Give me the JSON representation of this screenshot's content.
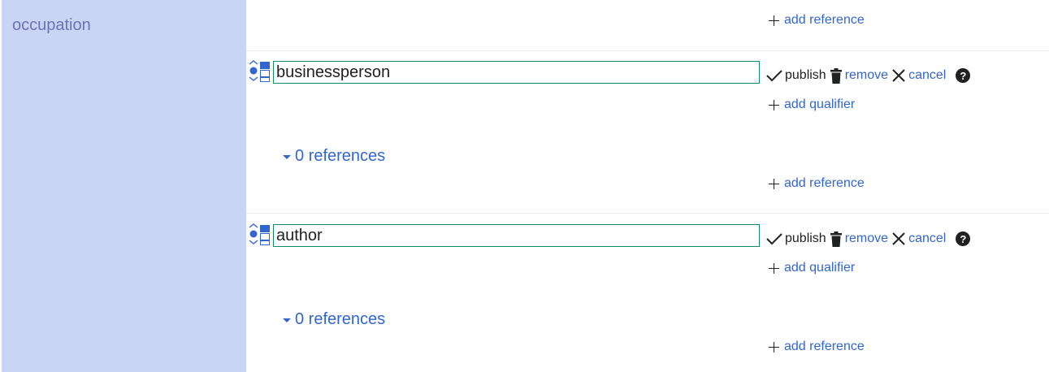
{
  "property": {
    "label": "occupation"
  },
  "actions": {
    "add_reference": "add reference",
    "add_qualifier": "add qualifier"
  },
  "toolbar": {
    "publish": "publish",
    "remove": "remove",
    "cancel": "cancel",
    "help": "?"
  },
  "statements": [
    {
      "value": "businessperson",
      "references": "0 references"
    },
    {
      "value": "author",
      "references": "0 references"
    }
  ],
  "icons": [
    "rank-selector-icon",
    "checkmark-icon",
    "trash-icon",
    "close-icon",
    "help-icon",
    "plus-icon",
    "triangle-down-icon"
  ],
  "colors": {
    "sidebar": "#cad5f5",
    "link": "#3366cc",
    "input_border": "#14866d"
  }
}
